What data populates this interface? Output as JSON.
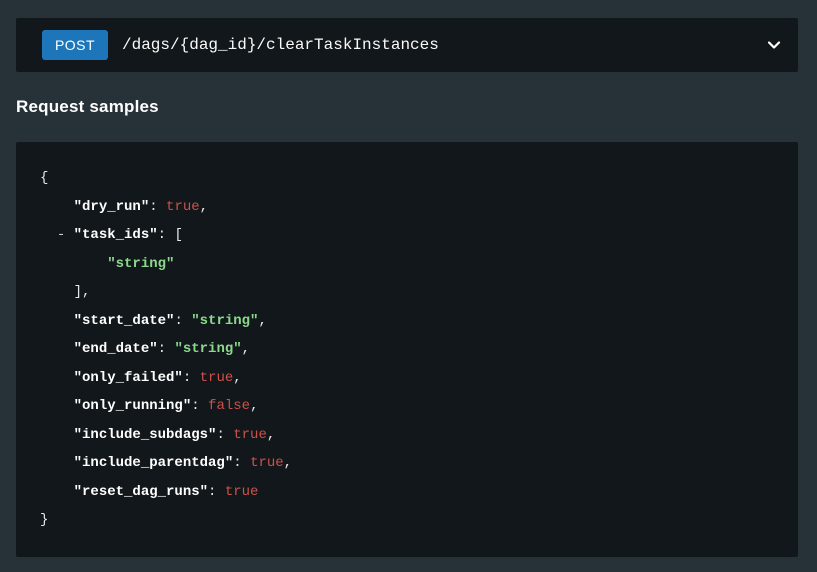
{
  "endpoint": {
    "method": "POST",
    "path": "/dags/{dag_id}/clearTaskInstances",
    "expand_icon": "chevron-down-icon"
  },
  "section_title": "Request samples",
  "code_sample": {
    "language": "json",
    "collapse_toggle_label": "-",
    "lines": [
      {
        "segments": [
          [
            "punct",
            "{"
          ]
        ]
      },
      {
        "segments": [
          [
            "punct",
            "    "
          ],
          [
            "key",
            "\"dry_run\""
          ],
          [
            "punct",
            ": "
          ],
          [
            "bool",
            "true"
          ],
          [
            "punct",
            ","
          ]
        ]
      },
      {
        "segments": [
          [
            "punct",
            "  "
          ],
          [
            "collapse",
            "-"
          ],
          [
            "punct",
            " "
          ],
          [
            "key",
            "\"task_ids\""
          ],
          [
            "punct",
            ": ["
          ]
        ]
      },
      {
        "segments": [
          [
            "punct",
            "        "
          ],
          [
            "string",
            "\"string\""
          ]
        ]
      },
      {
        "segments": [
          [
            "punct",
            "    ],"
          ]
        ]
      },
      {
        "segments": [
          [
            "punct",
            "    "
          ],
          [
            "key",
            "\"start_date\""
          ],
          [
            "punct",
            ": "
          ],
          [
            "string",
            "\"string\""
          ],
          [
            "punct",
            ","
          ]
        ]
      },
      {
        "segments": [
          [
            "punct",
            "    "
          ],
          [
            "key",
            "\"end_date\""
          ],
          [
            "punct",
            ": "
          ],
          [
            "string",
            "\"string\""
          ],
          [
            "punct",
            ","
          ]
        ]
      },
      {
        "segments": [
          [
            "punct",
            "    "
          ],
          [
            "key",
            "\"only_failed\""
          ],
          [
            "punct",
            ": "
          ],
          [
            "bool",
            "true"
          ],
          [
            "punct",
            ","
          ]
        ]
      },
      {
        "segments": [
          [
            "punct",
            "    "
          ],
          [
            "key",
            "\"only_running\""
          ],
          [
            "punct",
            ": "
          ],
          [
            "bool",
            "false"
          ],
          [
            "punct",
            ","
          ]
        ]
      },
      {
        "segments": [
          [
            "punct",
            "    "
          ],
          [
            "key",
            "\"include_subdags\""
          ],
          [
            "punct",
            ": "
          ],
          [
            "bool",
            "true"
          ],
          [
            "punct",
            ","
          ]
        ]
      },
      {
        "segments": [
          [
            "punct",
            "    "
          ],
          [
            "key",
            "\"include_parentdag\""
          ],
          [
            "punct",
            ": "
          ],
          [
            "bool",
            "true"
          ],
          [
            "punct",
            ","
          ]
        ]
      },
      {
        "segments": [
          [
            "punct",
            "    "
          ],
          [
            "key",
            "\"reset_dag_runs\""
          ],
          [
            "punct",
            ": "
          ],
          [
            "bool",
            "true"
          ]
        ]
      },
      {
        "segments": [
          [
            "punct",
            "}"
          ]
        ]
      }
    ]
  },
  "colors": {
    "page_bg": "#263238",
    "panel_bg": "#11171a",
    "method_bg": "#1d76ba",
    "key": "#ffffff",
    "punctuation": "#e8e8e8",
    "string": "#8cd98c",
    "boolean": "#d0504a",
    "heading": "#ffffff",
    "chevron": "#ffffff"
  }
}
